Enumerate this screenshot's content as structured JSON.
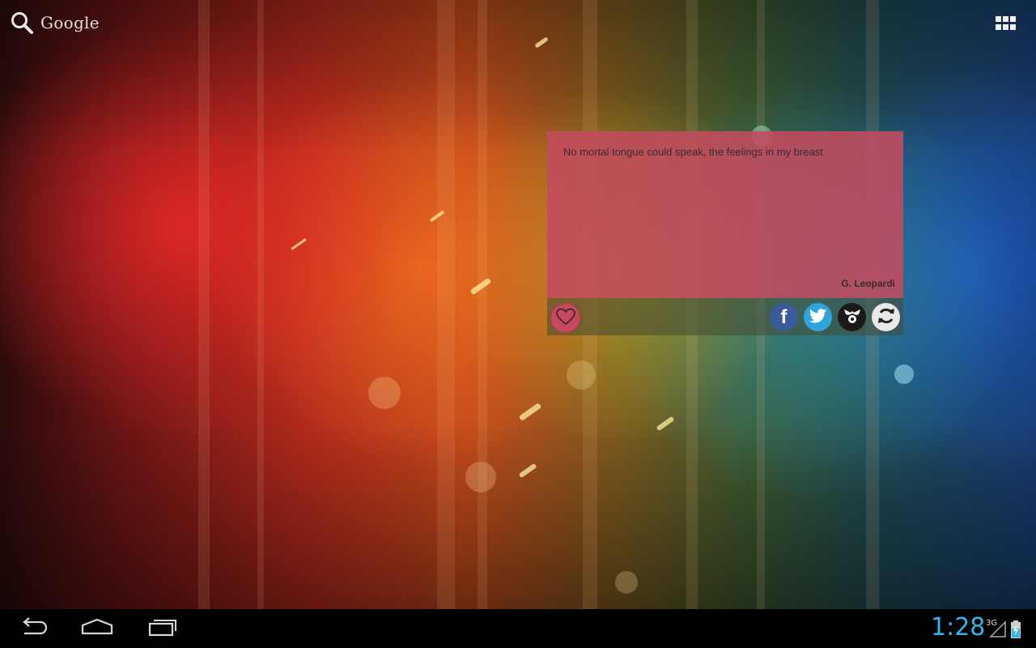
{
  "search": {
    "label": "Google",
    "icon": "search-icon"
  },
  "app_drawer": {
    "icon": "apps-grid-icon"
  },
  "quote_widget": {
    "text": "No mortal tongue could speak, the feelings in my breast",
    "author": "G. Leopardi",
    "card_color": "#c34b5f",
    "actions": [
      {
        "name": "favorite",
        "icon": "heart-icon"
      },
      {
        "name": "facebook",
        "icon": "facebook-icon",
        "glyph": "f"
      },
      {
        "name": "twitter",
        "icon": "twitter-icon"
      },
      {
        "name": "tumblr",
        "icon": "tumblr-icon"
      },
      {
        "name": "refresh",
        "icon": "refresh-icon"
      }
    ]
  },
  "navigation": {
    "back": {
      "icon": "back-icon"
    },
    "home": {
      "icon": "home-icon"
    },
    "recents": {
      "icon": "recent-apps-icon"
    }
  },
  "status": {
    "time": "1:28",
    "network": "3G",
    "clock_color": "#33b5e5"
  }
}
